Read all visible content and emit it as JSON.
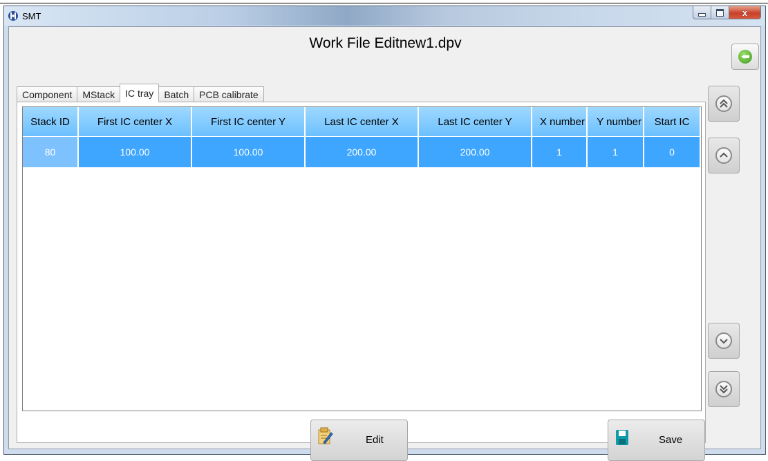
{
  "window": {
    "app_title": "SMT",
    "close_glyph": "x"
  },
  "header": {
    "title": "Work File Editnew1.dpv"
  },
  "tabs": [
    {
      "label": "Component",
      "active": false
    },
    {
      "label": "MStack",
      "active": false
    },
    {
      "label": "IC tray",
      "active": true
    },
    {
      "label": "Batch",
      "active": false
    },
    {
      "label": "PCB calibrate",
      "active": false
    }
  ],
  "table": {
    "columns": [
      "Stack ID",
      "First IC center X",
      "First IC center Y",
      "Last IC center X",
      "Last IC center Y",
      "X number",
      "Y number",
      "Start IC"
    ],
    "rows": [
      [
        "80",
        "100.00",
        "100.00",
        "200.00",
        "200.00",
        "1",
        "1",
        "0"
      ]
    ]
  },
  "side_nav": {
    "first_icon": "double-chevron-up-icon",
    "prev_icon": "chevron-up-icon",
    "next_icon": "chevron-down-icon",
    "last_icon": "double-chevron-down-icon"
  },
  "actions": {
    "edit_label": "Edit",
    "save_label": "Save"
  },
  "colors": {
    "header_bg": "#6cc0ff",
    "row_selected": "#3ea6ff",
    "back_button_green": "#3c9a1c",
    "save_icon": "#0f9aa8"
  }
}
